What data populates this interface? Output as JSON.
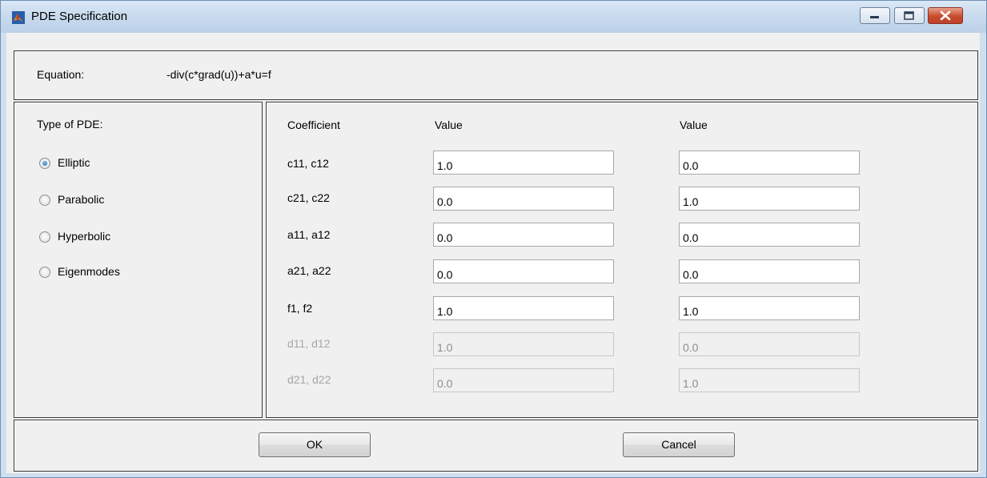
{
  "window": {
    "title": "PDE Specification"
  },
  "equation": {
    "label": "Equation:",
    "value": "-div(c*grad(u))+a*u=f"
  },
  "pde_type": {
    "label": "Type of PDE:",
    "options": [
      {
        "label": "Elliptic",
        "checked": true
      },
      {
        "label": "Parabolic",
        "checked": false
      },
      {
        "label": "Hyperbolic",
        "checked": false
      },
      {
        "label": "Eigenmodes",
        "checked": false
      }
    ]
  },
  "coefficients": {
    "header_coefficient": "Coefficient",
    "header_value1": "Value",
    "header_value2": "Value",
    "rows": [
      {
        "name": "c11, c12",
        "v1": "1.0",
        "v2": "0.0",
        "enabled": true
      },
      {
        "name": "c21, c22",
        "v1": "0.0",
        "v2": "1.0",
        "enabled": true
      },
      {
        "name": "a11, a12",
        "v1": "0.0",
        "v2": "0.0",
        "enabled": true
      },
      {
        "name": "a21, a22",
        "v1": "0.0",
        "v2": "0.0",
        "enabled": true
      },
      {
        "name": "f1, f2",
        "v1": "1.0",
        "v2": "1.0",
        "enabled": true
      },
      {
        "name": "d11, d12",
        "v1": "1.0",
        "v2": "0.0",
        "enabled": false
      },
      {
        "name": "d21, d22",
        "v1": "0.0",
        "v2": "1.0",
        "enabled": false
      }
    ]
  },
  "buttons": {
    "ok": "OK",
    "cancel": "Cancel"
  }
}
